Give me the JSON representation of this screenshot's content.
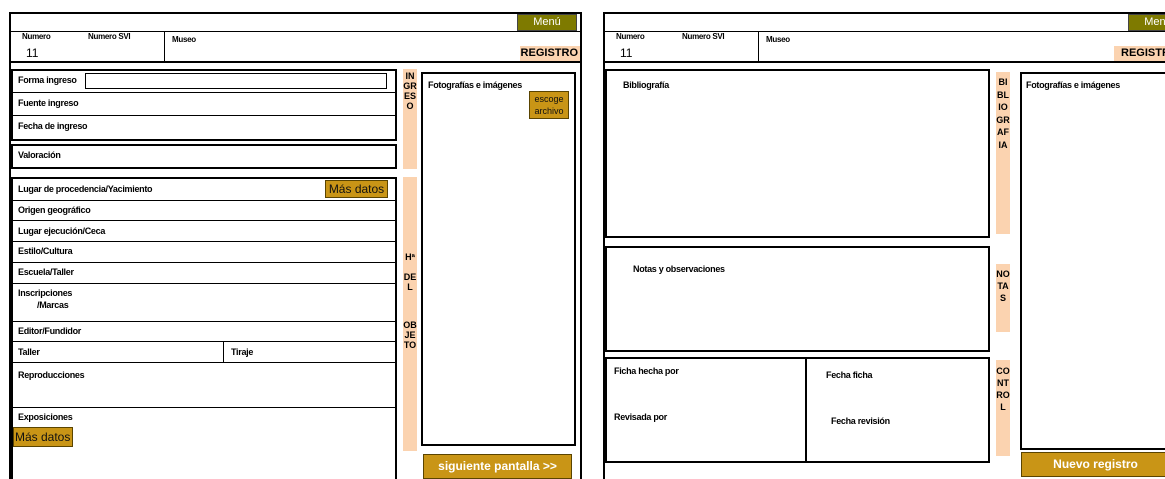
{
  "screen1": {
    "menu": "Menú",
    "numero_label": "Numero",
    "numero_value": "11",
    "numero_svi_label": "Numero SVI",
    "museo_label": "Museo",
    "registro": "REGISTRO",
    "forma_ingreso": "Forma ingreso",
    "forma_ingreso_value": "",
    "fuente_ingreso": "Fuente ingreso",
    "fecha_ingreso": "Fecha de ingreso",
    "valoracion": "Valoración",
    "strip_ingreso": "INGRESO",
    "lugar_procedencia": "Lugar de procedencia/Yacimiento",
    "mas_datos_1": "Más datos",
    "origen_geografico": "Origen geográfico",
    "lugar_ejecucion": "Lugar ejecución/Ceca",
    "estilo_cultura": "Estilo/Cultura",
    "escuela_taller": "Escuela/Taller",
    "inscripciones_1": "Inscripciones",
    "inscripciones_2": "/Marcas",
    "editor_fundidor": "Editor/Fundidor",
    "taller": "Taller",
    "tiraje": "Tiraje",
    "reproducciones": "Reproducciones",
    "exposiciones": "Exposiciones",
    "mas_datos_2": "Más datos",
    "strip_objeto_1": "Hª",
    "strip_objeto_2": "DEL",
    "strip_objeto_3": "OBJETO",
    "fotografias": "Fotografías e imágenes",
    "escoge_1": "escoge",
    "escoge_2": "archivo",
    "siguiente": "siguiente pantalla >>"
  },
  "screen2": {
    "menu": "Menú",
    "numero_label": "Numero",
    "numero_value": "11",
    "numero_svi_label": "Numero SVI",
    "museo_label": "Museo",
    "registro": "REGISTRO",
    "bibliografia": "Bibliografía",
    "strip_bibliografia": "BIBLIOGRAFIA",
    "notas": "Notas y observaciones",
    "strip_notas": "NOTAS",
    "ficha_hecha_por": "Ficha hecha por",
    "fecha_ficha": "Fecha ficha",
    "revisada_por": "Revisada por",
    "fecha_revision": "Fecha revisión",
    "strip_control": "CONTROL",
    "fotografias": "Fotografías e imágenes",
    "nuevo_registro": "Nuevo registro"
  },
  "colors": {
    "salmon": "#fbd3b0",
    "olive": "#7e7a00",
    "gold": "#c99516"
  }
}
